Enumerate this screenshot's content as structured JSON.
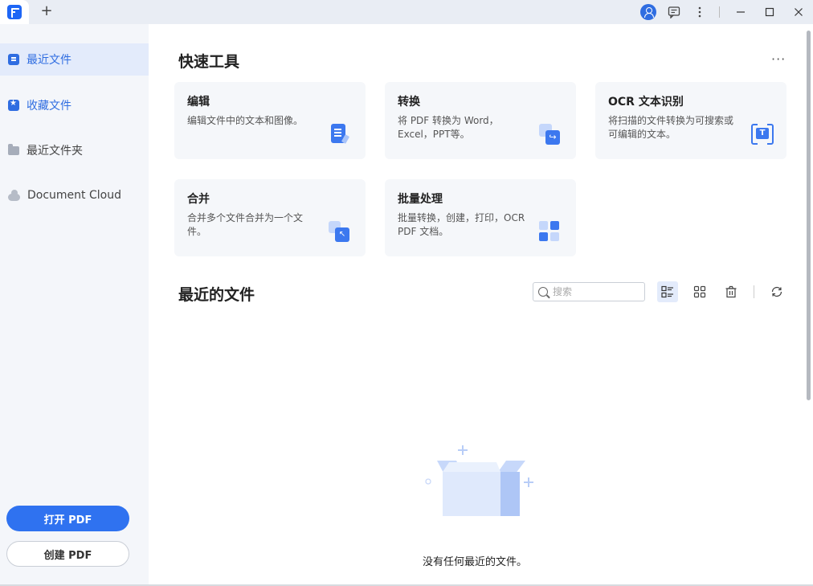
{
  "titlebar": {
    "new_tab_glyph": "+",
    "icons": [
      "avatar-icon",
      "comment-icon",
      "more-vertical-icon"
    ],
    "window_controls": [
      "minimize",
      "maximize",
      "close"
    ]
  },
  "sidebar": {
    "items": [
      {
        "label": "最近文件",
        "icon": "recent-files-icon"
      },
      {
        "label": "收藏文件",
        "icon": "star-icon"
      },
      {
        "label": "最近文件夹",
        "icon": "folder-icon"
      },
      {
        "label": "Document Cloud",
        "icon": "cloud-icon"
      }
    ],
    "open_pdf": "打开 PDF",
    "create_pdf": "创建 PDF"
  },
  "quick_tools": {
    "title": "快速工具",
    "more": "···",
    "cards": [
      {
        "title": "编辑",
        "desc": "编辑文件中的文本和图像。",
        "icon": "edit-icon"
      },
      {
        "title": "转换",
        "desc": "将 PDF 转换为 Word，Excel，PPT等。",
        "icon": "convert-icon"
      },
      {
        "title": "OCR 文本识别",
        "desc": "将扫描的文件转换为可搜索或可编辑的文本。",
        "icon": "ocr-icon"
      },
      {
        "title": "合并",
        "desc": "合并多个文件合并为一个文件。",
        "icon": "merge-icon"
      },
      {
        "title": "批量处理",
        "desc": "批量转换，创建，打印，OCR PDF 文档。",
        "icon": "batch-icon"
      }
    ]
  },
  "recent": {
    "title": "最近的文件",
    "search_placeholder": "搜索",
    "empty_text": "没有任何最近的文件。"
  },
  "colors": {
    "accent": "#2f72f0",
    "sidebar_bg": "#f4f6fa",
    "card_bg": "#f5f7fa",
    "titlebar_bg": "#e9edf4"
  }
}
